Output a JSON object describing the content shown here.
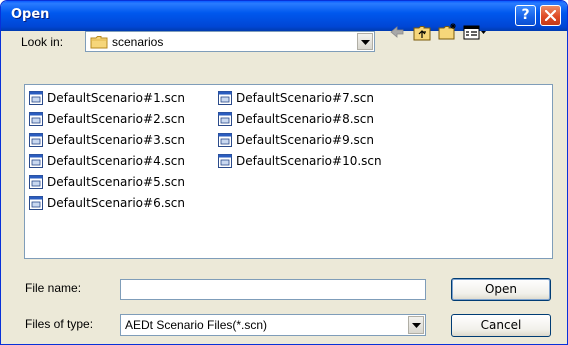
{
  "window": {
    "title": "Open"
  },
  "title_buttons": {
    "help": "?"
  },
  "look_in": {
    "label": "Look in:",
    "value": "scenarios"
  },
  "files": [
    "DefaultScenario#1.scn",
    "DefaultScenario#2.scn",
    "DefaultScenario#3.scn",
    "DefaultScenario#4.scn",
    "DefaultScenario#5.scn",
    "DefaultScenario#6.scn",
    "DefaultScenario#7.scn",
    "DefaultScenario#8.scn",
    "DefaultScenario#9.scn",
    "DefaultScenario#10.scn"
  ],
  "file_name": {
    "label": "File name:",
    "value": ""
  },
  "files_of_type": {
    "label": "Files of type:",
    "value": "AEDt Scenario Files(*.scn)"
  },
  "buttons": {
    "open": "Open",
    "cancel": "Cancel"
  },
  "icons": {
    "back": "back-arrow-icon",
    "up": "up-folder-icon",
    "new_folder": "new-folder-icon",
    "views": "view-menu-icon"
  },
  "colors": {
    "titlebar": "#0058ee",
    "close": "#df4b26",
    "dialog_bg": "#ece9d8"
  }
}
